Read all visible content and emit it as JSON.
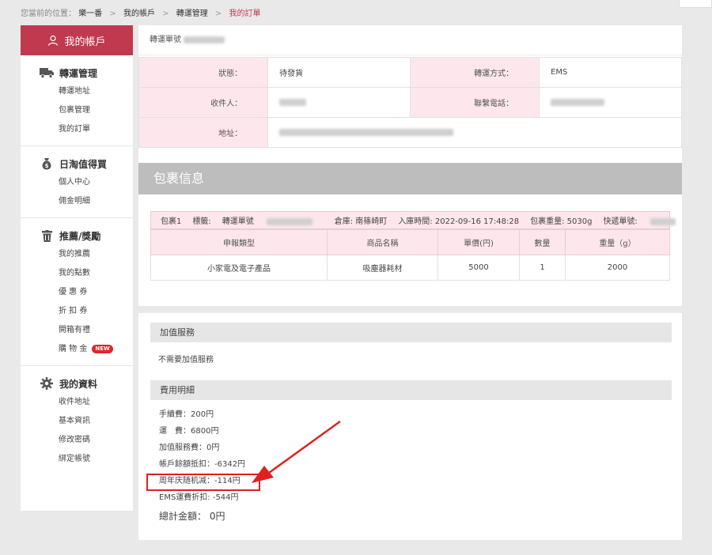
{
  "breadcrumb": {
    "prefix": "您當前的位置：",
    "items": [
      "樂一番",
      "我的帳戶",
      "轉運管理",
      "我的訂單"
    ],
    "separator": ">"
  },
  "sidebar": {
    "header": "我的帳戶",
    "groups": [
      {
        "title": "轉運管理",
        "icon": "truck-icon",
        "items": [
          "轉運地址",
          "包裹管理",
          "我的訂單"
        ]
      },
      {
        "title": "日淘值得買",
        "icon": "money-bag-icon",
        "items": [
          "個人中心",
          "佣金明細"
        ]
      },
      {
        "title": "推薦/獎勵",
        "icon": "trash-can-icon",
        "items": [
          "我的推薦",
          "我的點數",
          "優 惠 券",
          "折 扣 券",
          "開箱有禮",
          "購 物 金"
        ]
      },
      {
        "title": "我的資料",
        "icon": "gear-icon",
        "items": [
          "收件地址",
          "基本資訊",
          "修改密碼",
          "綁定帳號"
        ]
      }
    ],
    "new_badge": "NEW"
  },
  "order": {
    "shipno_label": "轉運單號",
    "rows": [
      {
        "label1": "狀態：",
        "value1": "待發貨",
        "label2": "轉運方式：",
        "value2": "EMS"
      },
      {
        "label1": "收件人：",
        "value1": "",
        "label2": "聯繫電話：",
        "value2": ""
      },
      {
        "label1": "地址：",
        "value1": ""
      }
    ]
  },
  "package": {
    "header": "包裹信息",
    "summary": {
      "pkg": "包裹1",
      "tag_label": "標籤:",
      "shipno_label": "轉運單號",
      "warehouse": "倉庫: 南篠崎町",
      "intime": "入庫時間: 2022-09-16 17:48:28",
      "weight": "包裹重量: 5030g",
      "express_label": "快遞單號:"
    },
    "columns": [
      "申報類型",
      "商品名稱",
      "單價(円)",
      "數量",
      "重量（g）"
    ],
    "rows": [
      [
        "小家電及電子產品",
        "吸塵器耗材",
        "5000",
        "1",
        "2000"
      ]
    ]
  },
  "services": {
    "title": "加值服務",
    "text": "不需要加值服務"
  },
  "fees": {
    "title": "費用明細",
    "lines": [
      "手續費：200円",
      "運　費：6800円",
      "加值服務費：0円",
      "帳戶餘額抵扣：-6342円",
      "周年庆随机减：-114円",
      "EMS運費折扣: -544円"
    ],
    "total": "總計金額： 0円"
  },
  "colors": {
    "accent": "#c1394f",
    "pink_bg": "#fde7ec",
    "annotation_red": "#e02020",
    "header_gray": "#bdbdbd"
  }
}
